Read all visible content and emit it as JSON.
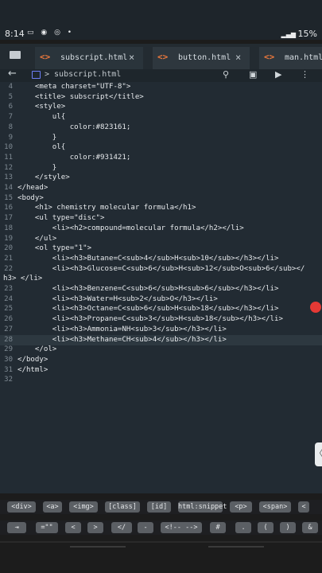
{
  "status": {
    "time": "8:14",
    "left_icons": "▭ ◉ ◎ •",
    "right": "15%"
  },
  "tabs": [
    {
      "label": "subscript.html",
      "code": "<>",
      "close": "×"
    },
    {
      "label": "button.html",
      "code": "<>",
      "close": "×"
    },
    {
      "label": "man.html",
      "code": "<>"
    }
  ],
  "toolbar": {
    "back": "←",
    "crumb": "> subscript.html",
    "search": "⚲",
    "save": "▣",
    "run": "▶",
    "more": "⋮"
  },
  "code_lines": [
    {
      "n": "4",
      "text": "    <meta charset=\"UTF-8\">"
    },
    {
      "n": "5",
      "text": "    <title> subscript</title>"
    },
    {
      "n": "6",
      "text": "    <style>"
    },
    {
      "n": "7",
      "text": "        ul{"
    },
    {
      "n": "8",
      "text": "            color:#823161;"
    },
    {
      "n": "9",
      "text": "        }"
    },
    {
      "n": "10",
      "text": "        ol{"
    },
    {
      "n": "11",
      "text": "            color:#931421;"
    },
    {
      "n": "12",
      "text": "        }"
    },
    {
      "n": "13",
      "text": "    </style>"
    },
    {
      "n": "14",
      "text": "</head>"
    },
    {
      "n": "15",
      "text": "<body>"
    },
    {
      "n": "16",
      "text": "    <h1> chemistry molecular formula</h1>"
    },
    {
      "n": "17",
      "text": "    <ul type=\"disc\">"
    },
    {
      "n": "18",
      "text": "        <li><h2>compound=molecular formula</h2></li>"
    },
    {
      "n": "19",
      "text": "    </ul>"
    },
    {
      "n": "20",
      "text": "    <ol type=\"1\">"
    },
    {
      "n": "21",
      "text": "        <li><h3>Butane=C<sub>4</sub>H<sub>10</sub></h3></li>"
    },
    {
      "n": "22",
      "text": "        <li><h3>Glucose=C<sub>6</sub>H<sub>12</sub>O<sub>6</sub></"
    },
    {
      "n": "",
      "text": "h3> </li>",
      "wrap": true
    },
    {
      "n": "23",
      "text": "        <li><h3>Benzene=C<sub>6</sub>H<sub>6</sub></h3></li>"
    },
    {
      "n": "24",
      "text": "        <li><h3>Water=H<sub>2</sub>O</h3></li>"
    },
    {
      "n": "25",
      "text": "        <li><h3>Octane=C<sub>6</sub>H<sub>18</sub></h3></li>"
    },
    {
      "n": "26",
      "text": "        <li><h3>Propane=C<sub>3</sub>H<sub>18</sub></h3></li>"
    },
    {
      "n": "27",
      "text": "        <li><h3>Ammonia=NH<sub>3</sub></h3></li>"
    },
    {
      "n": "28",
      "text": "        <li><h3>Methane=CH<sub>4</sub></h3></li>"
    },
    {
      "n": "29",
      "text": "    </ol>"
    },
    {
      "n": "30",
      "text": "</body>"
    },
    {
      "n": "31",
      "text": "</html>"
    },
    {
      "n": "32",
      "text": ""
    }
  ],
  "side_handle": "〈",
  "snippets_row1": [
    "<div>",
    "<a>",
    "<img>",
    "[class]",
    "[id]",
    "html:snippet",
    "<p>",
    "<span>",
    "<"
  ],
  "snippets_row2": [
    "⇥",
    "=\"\"",
    "<",
    ">",
    "</",
    "-",
    "<!-- -->",
    "#",
    ".",
    "(",
    ")",
    "&"
  ]
}
